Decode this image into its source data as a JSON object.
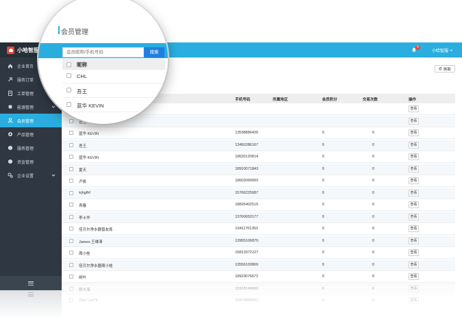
{
  "app": {
    "brand": "小哈智服"
  },
  "sidebar": {
    "items": [
      {
        "label": "企业首页",
        "icon": "home-icon"
      },
      {
        "label": "服务订单",
        "icon": "tools-icon",
        "chevron": true
      },
      {
        "label": "工单管理",
        "icon": "clipboard-icon",
        "chevron": true
      },
      {
        "label": "能源管理",
        "icon": "chip-icon",
        "chevron": true
      },
      {
        "label": "会员管理",
        "icon": "user-icon",
        "active": true
      },
      {
        "label": "产品管理",
        "icon": "target-icon"
      },
      {
        "label": "服务管理",
        "icon": "cube-icon"
      },
      {
        "label": "资金管理",
        "icon": "cube-icon"
      },
      {
        "label": "企业设置",
        "icon": "gear-icon",
        "chevron": true
      }
    ]
  },
  "header": {
    "badge": "5",
    "user": "小哈智服"
  },
  "toolbar": {
    "refresh": "刷新",
    "search_placeholder": "会员昵称/手机号码",
    "search_button": "搜索"
  },
  "page": {
    "title": "会员管理"
  },
  "table": {
    "columns": [
      "昵称",
      "手机号码",
      "所属地区",
      "会员积分",
      "交易次数",
      "操作"
    ],
    "action": "查看",
    "rows": [
      {
        "name": "CHL",
        "phone": "",
        "points": "",
        "trades": ""
      },
      {
        "name": "吾王",
        "phone": "",
        "points": "",
        "trades": ""
      },
      {
        "name": "蓝华 KEVIN",
        "phone": "13538886435",
        "points": "0",
        "trades": "0"
      },
      {
        "name": "吾王",
        "phone": "13450286167",
        "points": "0",
        "trades": "0"
      },
      {
        "name": "蓝华 KEVIN",
        "phone": "18620120814",
        "points": "0",
        "trades": "0"
      },
      {
        "name": "夏天",
        "phone": "18910071843",
        "points": "0",
        "trades": "0"
      },
      {
        "name": "卢俊",
        "phone": "18602069993",
        "points": "0",
        "trades": "0"
      },
      {
        "name": "trjhgfhf",
        "phone": "15766225687",
        "points": "0",
        "trades": "0"
      },
      {
        "name": "青春",
        "phone": "18826402515",
        "points": "0",
        "trades": "0"
      },
      {
        "name": "李士华",
        "phone": "13760653177",
        "points": "0",
        "trades": "0"
      },
      {
        "name": "佳贝尔净水器曾友炼",
        "phone": "13411761353",
        "points": "0",
        "trades": "0"
      },
      {
        "name": "James-王维清",
        "phone": "13955106870",
        "points": "0",
        "trades": "0"
      },
      {
        "name": "周小桂",
        "phone": "15813372127",
        "points": "0",
        "trades": "0"
      },
      {
        "name": "佳贝尔净水器周小桂",
        "phone": "13556100869",
        "points": "0",
        "trades": "0"
      },
      {
        "name": "树叶",
        "phone": "18923076672",
        "points": "0",
        "trades": "0"
      },
      {
        "name": "舒大海",
        "phone": "15918149680",
        "points": "0",
        "trades": "0"
      },
      {
        "name": "Zero Lee°8",
        "phone": "15814883561",
        "points": "0",
        "trades": "0"
      }
    ]
  },
  "magnifier": {
    "rows": [
      "CHL",
      "吾王",
      "蓝华 KEVIN"
    ]
  },
  "colors": {
    "accent": "#2aaee0",
    "sidebar": "#2f3842",
    "search_button": "#1f7fe0",
    "badge": "#e8433d"
  }
}
